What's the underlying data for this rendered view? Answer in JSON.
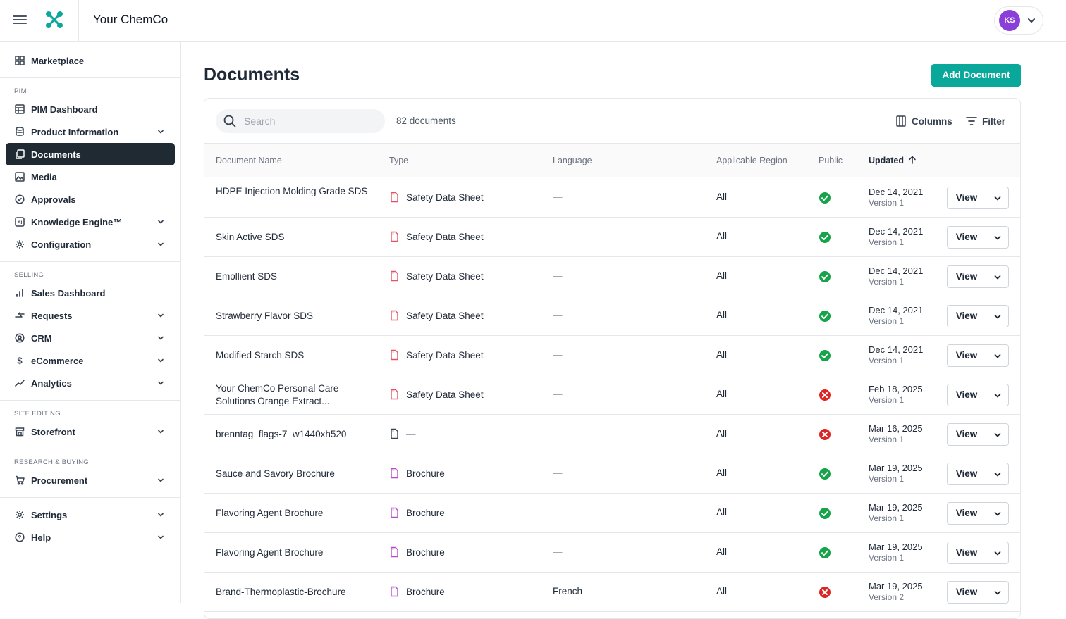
{
  "app": {
    "company": "Your ChemCo",
    "user_initials": "KS",
    "accent": "#0aa89b",
    "avatar_color": "#8b3fd9"
  },
  "sidebar": {
    "marketplace": "Marketplace",
    "sections": {
      "pim": "PIM",
      "selling": "SELLING",
      "site_editing": "SITE EDITING",
      "research": "RESEARCH & BUYING"
    },
    "items": {
      "pim_dashboard": "PIM Dashboard",
      "product_information": "Product Information",
      "documents": "Documents",
      "media": "Media",
      "approvals": "Approvals",
      "knowledge_engine": "Knowledge Engine™",
      "configuration": "Configuration",
      "sales_dashboard": "Sales Dashboard",
      "requests": "Requests",
      "crm": "CRM",
      "ecommerce": "eCommerce",
      "analytics": "Analytics",
      "storefront": "Storefront",
      "procurement": "Procurement",
      "settings": "Settings",
      "help": "Help"
    },
    "active": "documents"
  },
  "main": {
    "title": "Documents",
    "add_button": "Add Document",
    "search_placeholder": "Search",
    "doc_count": "82 documents",
    "columns_label": "Columns",
    "filter_label": "Filter"
  },
  "table": {
    "headers": {
      "name": "Document Name",
      "type": "Type",
      "language": "Language",
      "region": "Applicable Region",
      "public": "Public",
      "updated": "Updated"
    },
    "view_label": "View",
    "rows": [
      {
        "name": "HDPE Injection Molding Grade SDS",
        "type": "Safety Data Sheet",
        "type_kind": "sds",
        "language": "—",
        "region": "All",
        "public": true,
        "date": "Dec 14, 2021",
        "version": "Version 1"
      },
      {
        "name": "Skin Active SDS",
        "type": "Safety Data Sheet",
        "type_kind": "sds",
        "language": "—",
        "region": "All",
        "public": true,
        "date": "Dec 14, 2021",
        "version": "Version 1"
      },
      {
        "name": "Emollient SDS",
        "type": "Safety Data Sheet",
        "type_kind": "sds",
        "language": "—",
        "region": "All",
        "public": true,
        "date": "Dec 14, 2021",
        "version": "Version 1"
      },
      {
        "name": "Strawberry Flavor SDS",
        "type": "Safety Data Sheet",
        "type_kind": "sds",
        "language": "—",
        "region": "All",
        "public": true,
        "date": "Dec 14, 2021",
        "version": "Version 1"
      },
      {
        "name": "Modified Starch SDS",
        "type": "Safety Data Sheet",
        "type_kind": "sds",
        "language": "—",
        "region": "All",
        "public": true,
        "date": "Dec 14, 2021",
        "version": "Version 1"
      },
      {
        "name": "Your ChemCo Personal Care Solutions Orange Extract...",
        "type": "Safety Data Sheet",
        "type_kind": "sds",
        "language": "—",
        "region": "All",
        "public": false,
        "date": "Feb 18, 2025",
        "version": "Version 1"
      },
      {
        "name": "brenntag_flags-7_w1440xh520",
        "type": "—",
        "type_kind": "none",
        "language": "—",
        "region": "All",
        "public": false,
        "date": "Mar 16, 2025",
        "version": "Version 1"
      },
      {
        "name": "Sauce and Savory Brochure",
        "type": "Brochure",
        "type_kind": "brochure",
        "language": "—",
        "region": "All",
        "public": true,
        "date": "Mar 19, 2025",
        "version": "Version 1"
      },
      {
        "name": "Flavoring Agent Brochure",
        "type": "Brochure",
        "type_kind": "brochure",
        "language": "—",
        "region": "All",
        "public": true,
        "date": "Mar 19, 2025",
        "version": "Version 1"
      },
      {
        "name": "Flavoring Agent Brochure",
        "type": "Brochure",
        "type_kind": "brochure",
        "language": "—",
        "region": "All",
        "public": true,
        "date": "Mar 19, 2025",
        "version": "Version 1"
      },
      {
        "name": "Brand-Thermoplastic-Brochure",
        "type": "Brochure",
        "type_kind": "brochure",
        "language": "French",
        "region": "All",
        "public": false,
        "date": "Mar 19, 2025",
        "version": "Version 2"
      }
    ]
  },
  "colors": {
    "public_yes": "#16a34a",
    "public_no": "#dc2626",
    "sds_icon": "#e05563",
    "brochure_icon": "#b54cc9",
    "none_icon": "#374151"
  }
}
